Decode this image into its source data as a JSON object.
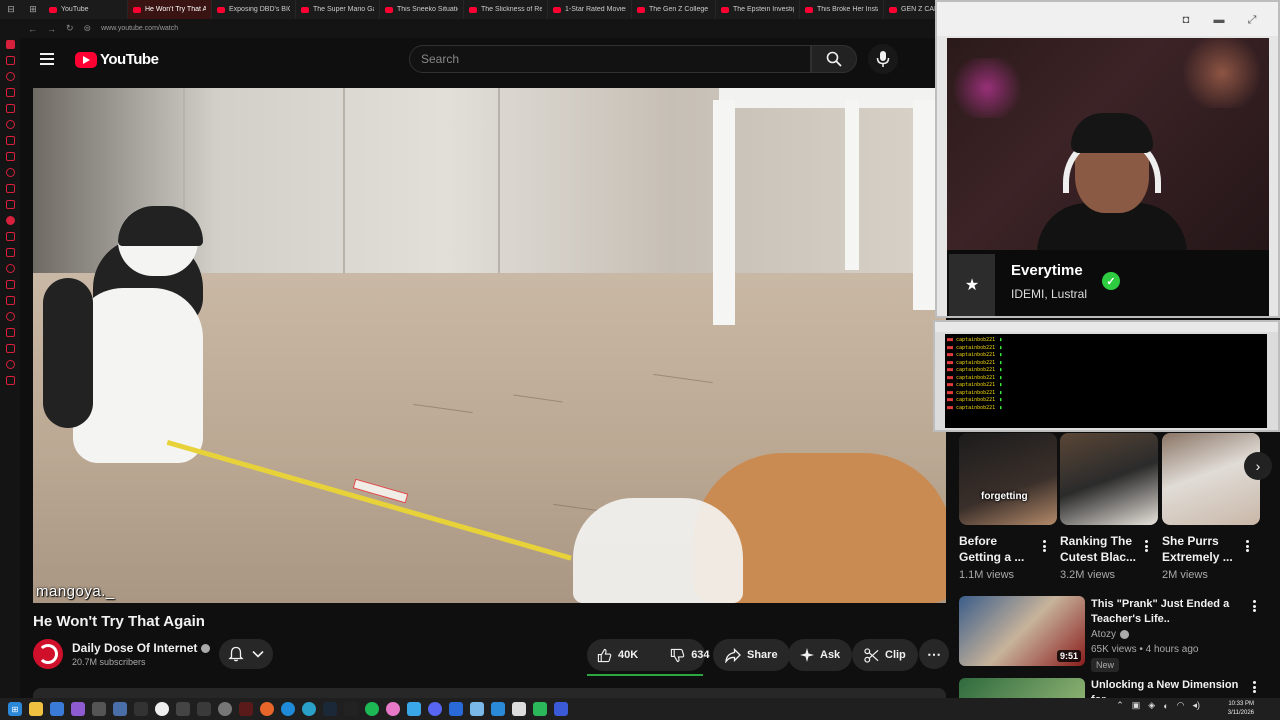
{
  "browser": {
    "tabs": [
      {
        "label": "YouTube",
        "active": false
      },
      {
        "label": "He Won't Try That Again",
        "active": true
      },
      {
        "label": "Exposing DBD's BIGG",
        "active": false
      },
      {
        "label": "The Super Mario Gal",
        "active": false
      },
      {
        "label": "This Sneeko Situatio",
        "active": false
      },
      {
        "label": "The Slickness of Re",
        "active": false
      },
      {
        "label": "1-Star Rated Movies",
        "active": false
      },
      {
        "label": "The Gen Z College C",
        "active": false
      },
      {
        "label": "The Epstein Investig",
        "active": false
      },
      {
        "label": "This Broke Her Insta",
        "active": false
      },
      {
        "label": "GEN Z CAN'T Ans",
        "active": false
      }
    ],
    "url": "www.youtube.com/watch"
  },
  "header": {
    "logo_text": "YouTube",
    "search_placeholder": "Search"
  },
  "video": {
    "watermark": "mangoya._",
    "title": "He Won't Try That Again",
    "channel": "Daily Dose Of Internet",
    "subscribers": "20.7M subscribers",
    "likes": "40K",
    "dislikes": "634",
    "like_share_fraction": 0.98,
    "share_label": "Share",
    "ask_label": "Ask",
    "clip_label": "Clip"
  },
  "overlay": {
    "song_title": "Everytime",
    "song_artist": "IDEMI, Lustral",
    "chat_lines": [
      "captainbob221",
      "captainbob221",
      "captainbob221",
      "captainbob221",
      "captainbob221",
      "captainbob221",
      "captainbob221",
      "captainbob221",
      "captainbob221",
      "captainbob221"
    ]
  },
  "shorts": [
    {
      "title_line1": "Before",
      "title_line2": "Getting a ...",
      "views": "1.1M views",
      "caption": "forgetting"
    },
    {
      "title_line1": "Ranking The",
      "title_line2": "Cutest Blac...",
      "views": "3.2M views",
      "caption": ""
    },
    {
      "title_line1": "She Purrs",
      "title_line2": "Extremely ...",
      "views": "2M views",
      "caption": ""
    }
  ],
  "recommended": [
    {
      "title_line1": "This \"Prank\" Just Ended a",
      "title_line2": "Teacher's Life..",
      "channel": "Atozy",
      "meta": "65K views • 4 hours ago",
      "badge": "New",
      "duration": "9:51"
    },
    {
      "title_line1": "Unlocking a New Dimension for",
      "title_line2": "",
      "channel": "",
      "meta": "",
      "badge": "",
      "duration": ""
    }
  ],
  "taskbar": {
    "time": "10:33 PM",
    "date": "3/11/2026"
  },
  "colors": {
    "accent": "#ff0033",
    "background": "#0f0f0f",
    "like_bar": "#2ba640"
  }
}
